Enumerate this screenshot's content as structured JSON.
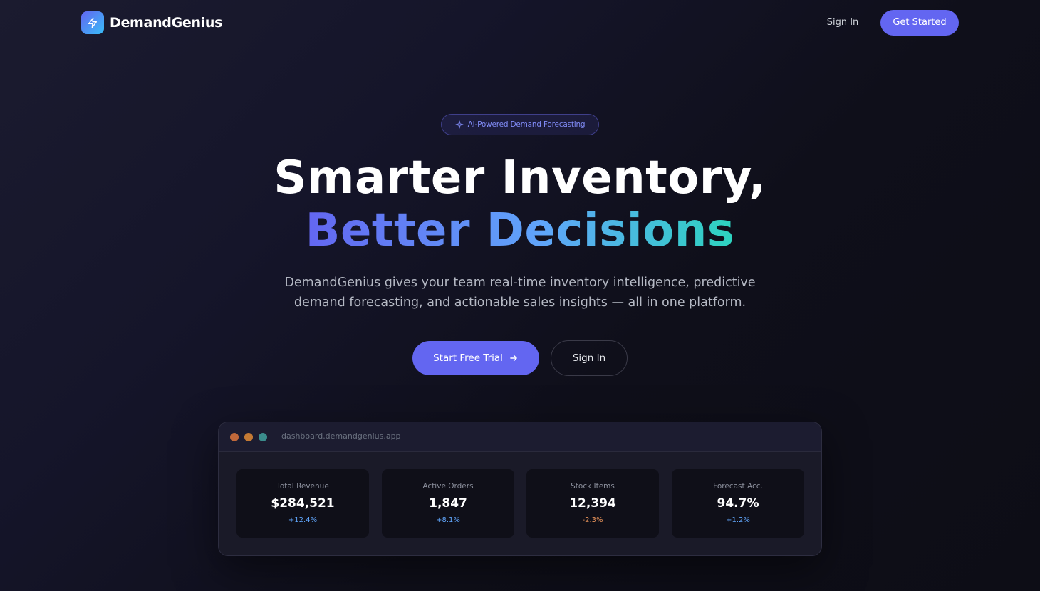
{
  "brand": {
    "name": "DemandGenius"
  },
  "nav": {
    "signin_label": "Sign In",
    "cta_label": "Get Started"
  },
  "hero": {
    "badge": "AI-Powered Demand Forecasting",
    "title_line1": "Smarter Inventory,",
    "title_line2": "Better Decisions",
    "subtitle_line1": "DemandGenius gives your team real-time inventory intelligence, predictive",
    "subtitle_line2": "demand forecasting, and actionable sales insights — all in one platform.",
    "primary_cta": "Start Free Trial",
    "secondary_cta": "Sign In"
  },
  "dashboard": {
    "url": "dashboard.demandgenius.app",
    "stats": [
      {
        "label": "Total Revenue",
        "value": "$284,521",
        "delta": "+12.4%"
      },
      {
        "label": "Active Orders",
        "value": "1,847",
        "delta": "+8.1%"
      },
      {
        "label": "Stock Items",
        "value": "12,394",
        "delta": "-2.3%"
      },
      {
        "label": "Forecast Acc.",
        "value": "94.7%",
        "delta": "+1.2%"
      }
    ]
  },
  "colors": {
    "accent": "#6366f1",
    "positive": "#60a5fa",
    "negative": "#e8935a"
  }
}
